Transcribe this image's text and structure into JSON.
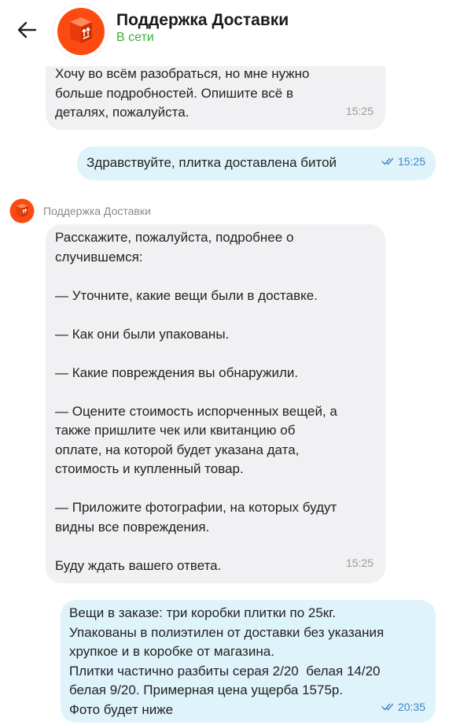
{
  "header": {
    "title": "Поддержка Доставки",
    "status": "В сети"
  },
  "messages": [
    {
      "direction": "incoming",
      "text": "Хочу во всём разобраться, но мне нужно\nбольше подробностей. Опишите всё в\nдеталях, пожалуйста.",
      "time": "15:25"
    },
    {
      "direction": "outgoing",
      "text": "Здравствуйте, плитка доставлена битой",
      "time": "15:25",
      "read": true
    },
    {
      "direction": "incoming",
      "sender": "Поддержка Доставки",
      "text": "Расскажите, пожалуйста, подробнее о\nслучившемся:\n\n— Уточните, какие вещи были в доставке.\n\n— Как они были упакованы.\n\n— Какие повреждения вы обнаружили.\n\n— Оцените стоимость испорченных вещей, а\nтакже пришлите чек или квитанцию об\nоплате, на которой будет указана дата,\nстоимость и купленный товар.\n\n— Приложите фотографии, на которых будут\nвидны все повреждения.\n\nБуду ждать вашего ответа.",
      "time": "15:25"
    },
    {
      "direction": "outgoing",
      "text": "Вещи в заказе: три коробки плитки по 25кг.\nУпакованы в полиэтилен от доставки без указания\nхрупкое и в коробке от магазина.\nПлитки частично разбиты серая 2/20  белая 14/20\nбелая 9/20. Примерная цена ущерба 1575р.\nФото будет ниже",
      "time": "20:35",
      "read": true
    }
  ],
  "icons": {
    "back": "arrow-left-icon",
    "avatar": "delivery-box-icon",
    "read_receipt": "double-check-icon"
  },
  "colors": {
    "status_online": "#3cae3c",
    "brand": "#fc4b12",
    "incoming_bubble": "#f1f1f3",
    "outgoing_bubble": "#dff3fb",
    "read_check": "#3d87c6"
  }
}
